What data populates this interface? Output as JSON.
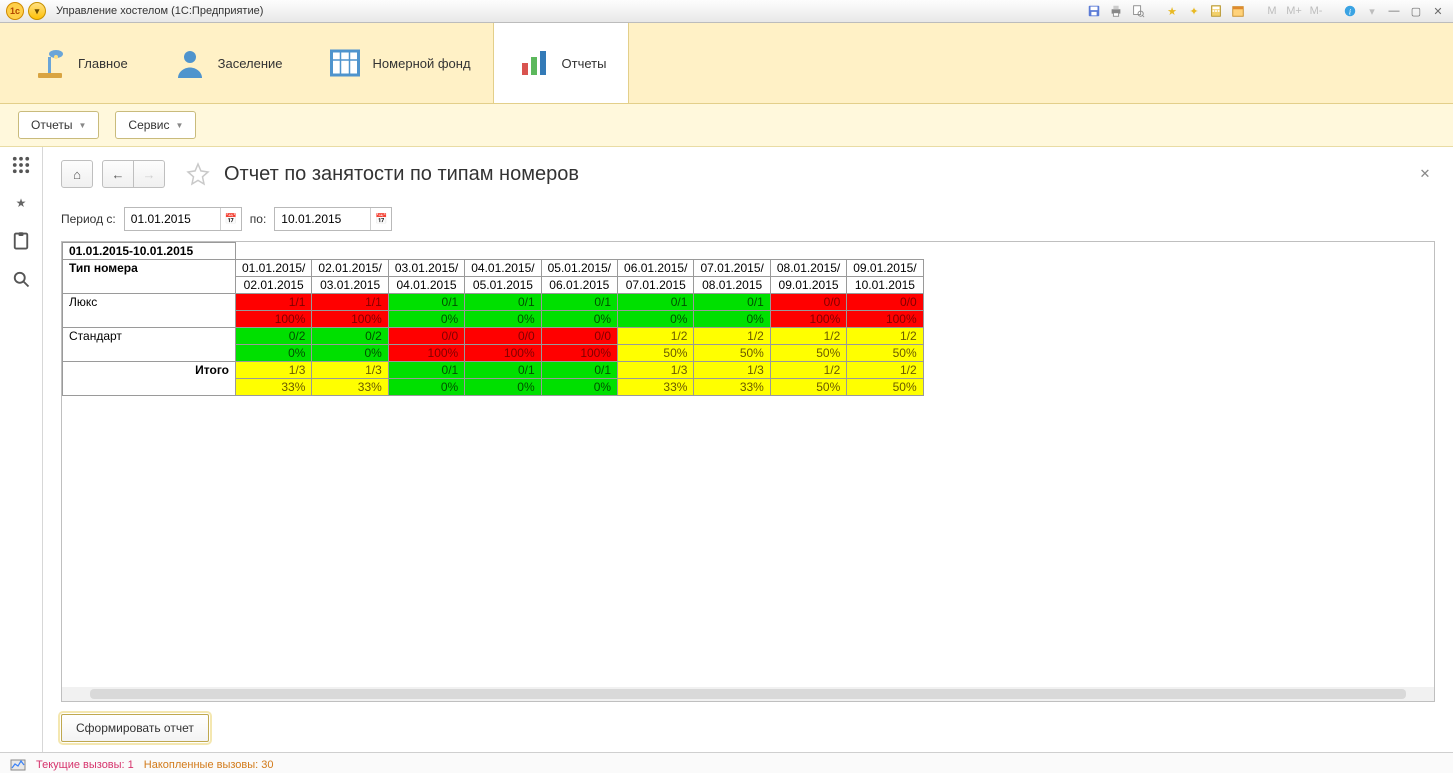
{
  "title": "Управление хостелом  (1С:Предприятие)",
  "titlebar_tools": {
    "m": "M",
    "mplus": "M+",
    "mminus": "M-"
  },
  "nav": {
    "main": "Главное",
    "checkin": "Заселение",
    "rooms": "Номерной фонд",
    "reports": "Отчеты"
  },
  "subbar": {
    "reports": "Отчеты",
    "service": "Сервис"
  },
  "page": {
    "title": "Отчет по занятости по типам номеров",
    "period_from_label": "Период с:",
    "period_to_label": "по:",
    "date_from": "01.01.2015",
    "date_to": "10.01.2015",
    "generate": "Сформировать отчет"
  },
  "report": {
    "range": "01.01.2015-10.01.2015",
    "type_header": "Тип номера",
    "columns": [
      {
        "l1": "01.01.2015/",
        "l2": "02.01.2015"
      },
      {
        "l1": "02.01.2015/",
        "l2": "03.01.2015"
      },
      {
        "l1": "03.01.2015/",
        "l2": "04.01.2015"
      },
      {
        "l1": "04.01.2015/",
        "l2": "05.01.2015"
      },
      {
        "l1": "05.01.2015/",
        "l2": "06.01.2015"
      },
      {
        "l1": "06.01.2015/",
        "l2": "07.01.2015"
      },
      {
        "l1": "07.01.2015/",
        "l2": "08.01.2015"
      },
      {
        "l1": "08.01.2015/",
        "l2": "09.01.2015"
      },
      {
        "l1": "09.01.2015/",
        "l2": "10.01.2015"
      }
    ],
    "rows": [
      {
        "label": "Люкс",
        "cells": [
          {
            "v1": "1/1",
            "v2": "100%",
            "c": "red"
          },
          {
            "v1": "1/1",
            "v2": "100%",
            "c": "red"
          },
          {
            "v1": "0/1",
            "v2": "0%",
            "c": "green"
          },
          {
            "v1": "0/1",
            "v2": "0%",
            "c": "green"
          },
          {
            "v1": "0/1",
            "v2": "0%",
            "c": "green"
          },
          {
            "v1": "0/1",
            "v2": "0%",
            "c": "green"
          },
          {
            "v1": "0/1",
            "v2": "0%",
            "c": "green"
          },
          {
            "v1": "0/0",
            "v2": "100%",
            "c": "red"
          },
          {
            "v1": "0/0",
            "v2": "100%",
            "c": "red"
          }
        ]
      },
      {
        "label": "Стандарт",
        "cells": [
          {
            "v1": "0/2",
            "v2": "0%",
            "c": "green"
          },
          {
            "v1": "0/2",
            "v2": "0%",
            "c": "green"
          },
          {
            "v1": "0/0",
            "v2": "100%",
            "c": "red"
          },
          {
            "v1": "0/0",
            "v2": "100%",
            "c": "red"
          },
          {
            "v1": "0/0",
            "v2": "100%",
            "c": "red"
          },
          {
            "v1": "1/2",
            "v2": "50%",
            "c": "yellow"
          },
          {
            "v1": "1/2",
            "v2": "50%",
            "c": "yellow"
          },
          {
            "v1": "1/2",
            "v2": "50%",
            "c": "yellow"
          },
          {
            "v1": "1/2",
            "v2": "50%",
            "c": "yellow"
          }
        ]
      },
      {
        "label": "Итого",
        "total": true,
        "cells": [
          {
            "v1": "1/3",
            "v2": "33%",
            "c": "yellow"
          },
          {
            "v1": "1/3",
            "v2": "33%",
            "c": "yellow"
          },
          {
            "v1": "0/1",
            "v2": "0%",
            "c": "green"
          },
          {
            "v1": "0/1",
            "v2": "0%",
            "c": "green"
          },
          {
            "v1": "0/1",
            "v2": "0%",
            "c": "green"
          },
          {
            "v1": "1/3",
            "v2": "33%",
            "c": "yellow"
          },
          {
            "v1": "1/3",
            "v2": "33%",
            "c": "yellow"
          },
          {
            "v1": "1/2",
            "v2": "50%",
            "c": "yellow"
          },
          {
            "v1": "1/2",
            "v2": "50%",
            "c": "yellow"
          }
        ]
      }
    ]
  },
  "status": {
    "current_calls": "Текущие вызовы: 1",
    "accum_calls": "Накопленные вызовы: 30"
  }
}
